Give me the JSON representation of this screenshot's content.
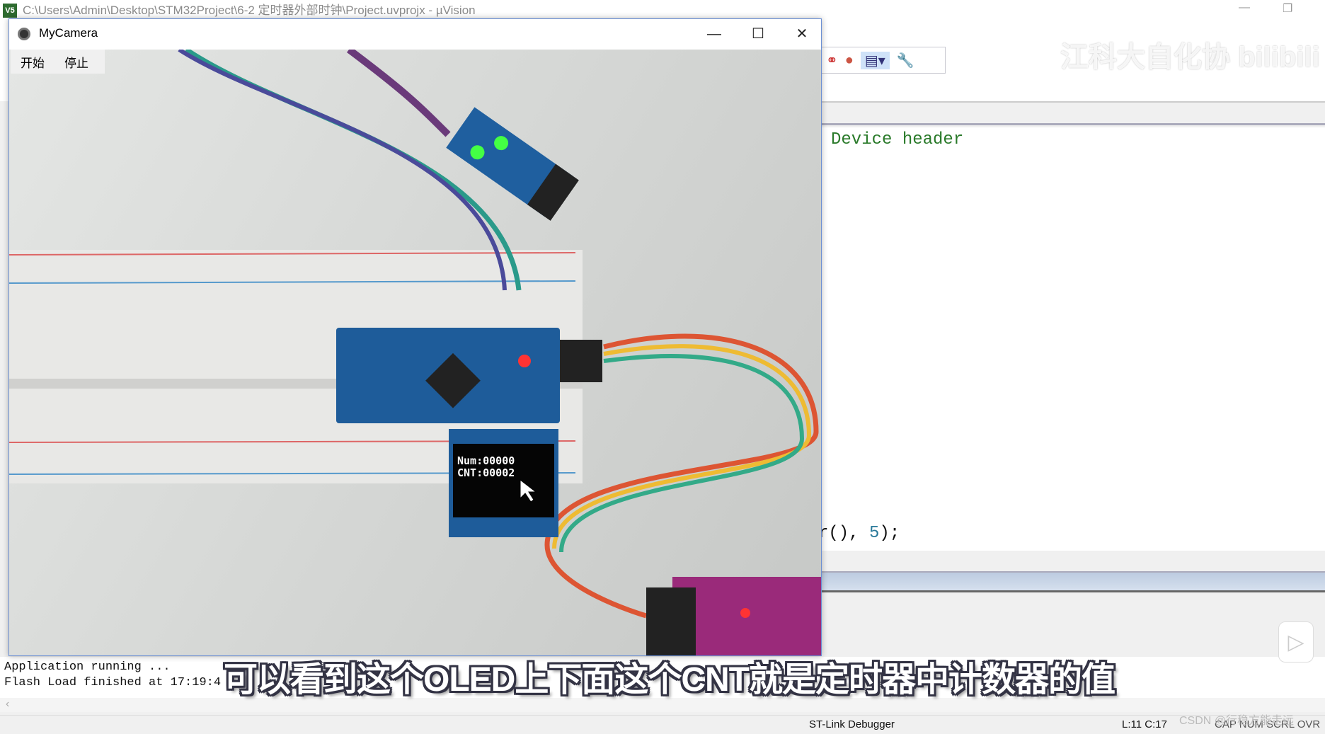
{
  "ide": {
    "title": "C:\\Users\\Admin\\Desktop\\STM32Project\\6-2 定时器外部时钟\\Project.uvprojx - µVision",
    "logo": "V5",
    "code": {
      "line1": "Device header",
      "line2_prefix": "r(), ",
      "line2_num": "5",
      "line2_suffix": ");"
    },
    "output": [
      "Application running ...",
      "Flash Load finished at 17:19:4"
    ],
    "status": {
      "debugger": "ST-Link Debugger",
      "position": "L:11 C:17",
      "flags": "CAP  NUM  SCRL  OVR"
    },
    "icons": [
      "breakpoint-icon",
      "kill-breakpoints-icon",
      "window-layout-icon",
      "wrench-icon"
    ]
  },
  "camera": {
    "title": "MyCamera",
    "menu": [
      {
        "label": "开始"
      },
      {
        "label": "停止"
      }
    ],
    "oled": {
      "line1": "Num:00000",
      "line2": "CNT:00002"
    }
  },
  "overlay": {
    "subtitle": "可以看到这个OLED上下面这个CNT就是定时器中计数器的值",
    "watermark": "江科大自化协 bilibili",
    "csdn": "CSDN @行稳方能走远"
  }
}
